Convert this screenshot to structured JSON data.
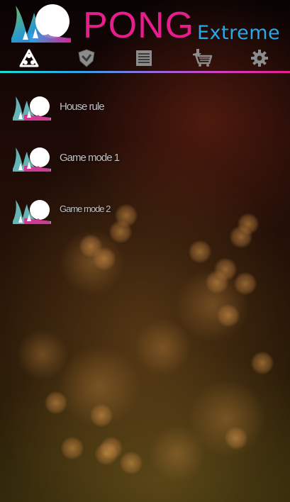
{
  "app": {
    "title": "PONG",
    "subtitle": "Extreme",
    "logo_icon": "pong-splash-logo"
  },
  "colors": {
    "title": "#e61e8c",
    "subtitle": "#2aa8e6",
    "icon_active": "#ffffff",
    "icon_inactive": "#9a9a9a",
    "label": "#bfbfbf"
  },
  "toolbar": {
    "items": [
      {
        "name": "game-modes",
        "icon": "triangle-circles-icon",
        "active": true
      },
      {
        "name": "achievements",
        "icon": "shield-badge-icon",
        "active": false
      },
      {
        "name": "leaderboard",
        "icon": "list-icon",
        "active": false
      },
      {
        "name": "store",
        "icon": "cart-icon",
        "active": false
      },
      {
        "name": "settings",
        "icon": "gear-icon",
        "active": false
      }
    ]
  },
  "modes": [
    {
      "label": "House rule",
      "icon": "pong-splash-icon"
    },
    {
      "label": "Game mode 1",
      "icon": "pong-splash-icon"
    },
    {
      "label": "Game mode 2",
      "icon": "pong-splash-icon"
    }
  ]
}
